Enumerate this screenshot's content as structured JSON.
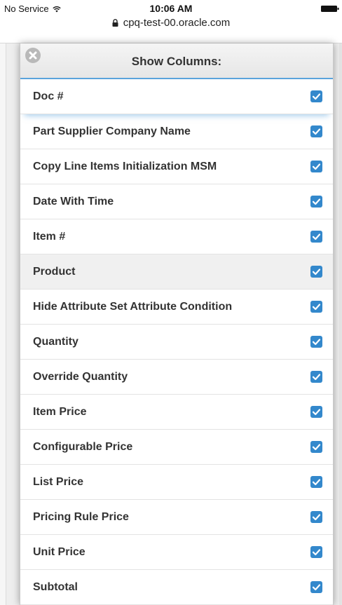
{
  "status_bar": {
    "carrier": "No Service",
    "time": "10:06 AM",
    "url": "cpq-test-00.oracle.com",
    "icons": [
      "wifi-icon",
      "battery-icon",
      "lock-icon"
    ]
  },
  "modal": {
    "title": "Show Columns:",
    "close_icon": "close-icon",
    "accent_color": "#5aa3dc",
    "checkbox_color": "#3388cc",
    "columns": [
      {
        "label": "Doc #",
        "checked": true
      },
      {
        "label": "Part Supplier Company Name",
        "checked": true
      },
      {
        "label": "Copy Line Items Initialization MSM",
        "checked": true
      },
      {
        "label": "Date With Time",
        "checked": true
      },
      {
        "label": "Item #",
        "checked": true
      },
      {
        "label": "Product",
        "checked": true
      },
      {
        "label": "Hide Attribute Set Attribute Condition",
        "checked": true
      },
      {
        "label": "Quantity",
        "checked": true
      },
      {
        "label": "Override Quantity",
        "checked": true
      },
      {
        "label": "Item Price",
        "checked": true
      },
      {
        "label": "Configurable Price",
        "checked": true
      },
      {
        "label": "List Price",
        "checked": true
      },
      {
        "label": "Pricing Rule Price",
        "checked": true
      },
      {
        "label": "Unit Price",
        "checked": true
      },
      {
        "label": "Subtotal",
        "checked": true
      }
    ]
  }
}
